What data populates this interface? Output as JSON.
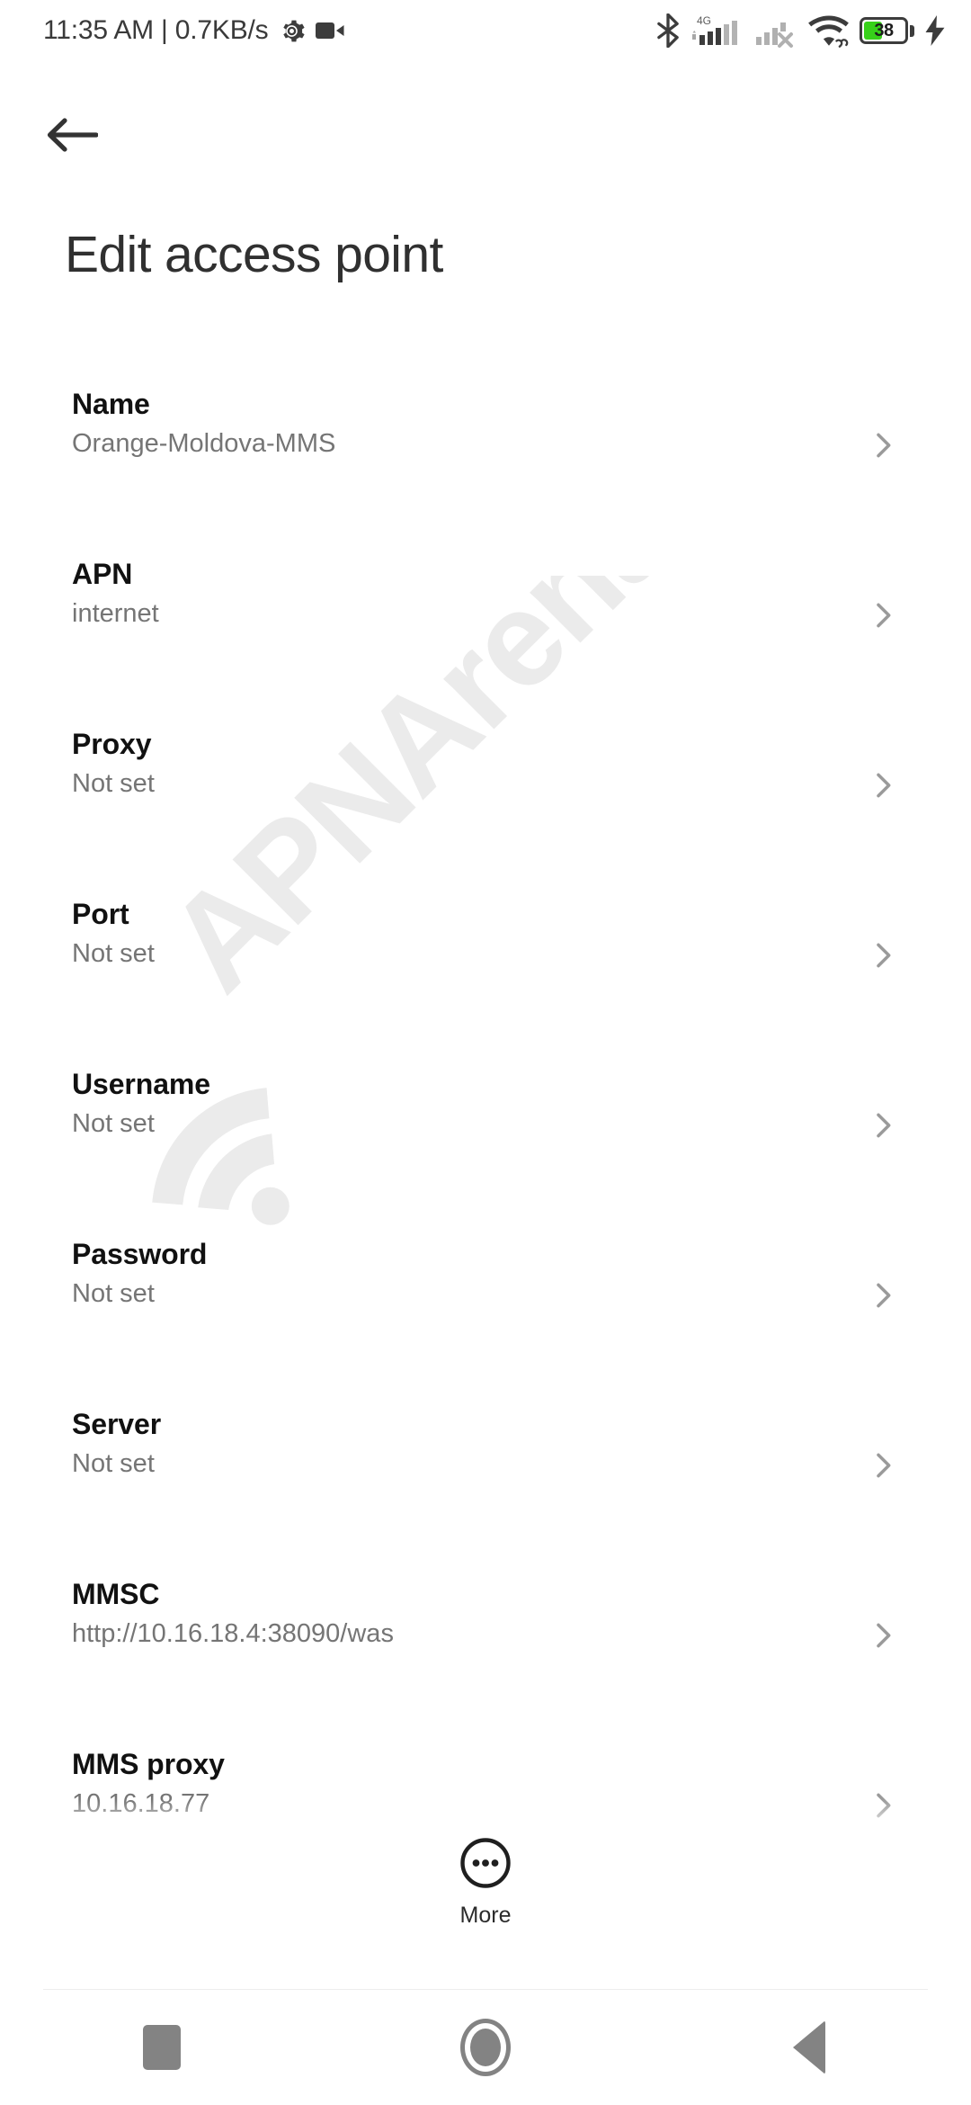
{
  "status_bar": {
    "clock": "11:35 AM | 0.7KB/s",
    "icons_left": [
      "gear-icon",
      "screen-record-icon"
    ],
    "icons_right": [
      "bluetooth-icon",
      "signal-sim1-4g-icon",
      "signal-sim2-no-service-icon",
      "wifi-icon",
      "battery-icon",
      "charging-bolt-icon"
    ],
    "network_type": "4G",
    "battery_percent": "38",
    "battery_fill_color": "#37d11a",
    "icon_color": "#3c3c3c"
  },
  "app_bar": {
    "back_icon": "arrow-left-icon",
    "title": "Edit access point"
  },
  "watermark": {
    "text": "APNArena",
    "color": "#ebebeb"
  },
  "preferences": [
    {
      "title": "Name",
      "value": "Orange-Moldova-MMS"
    },
    {
      "title": "APN",
      "value": "internet"
    },
    {
      "title": "Proxy",
      "value": "Not set"
    },
    {
      "title": "Port",
      "value": "Not set"
    },
    {
      "title": "Username",
      "value": "Not set"
    },
    {
      "title": "Password",
      "value": "Not set"
    },
    {
      "title": "Server",
      "value": "Not set"
    },
    {
      "title": "MMSC",
      "value": "http://10.16.18.4:38090/was"
    },
    {
      "title": "MMS proxy",
      "value": "10.16.18.77"
    }
  ],
  "more_button": {
    "label": "More",
    "icon": "ellipsis-circle-icon"
  },
  "nav_bar": {
    "recents_label": "Recents",
    "home_label": "Home",
    "back_label": "Back",
    "color": "#838383"
  }
}
